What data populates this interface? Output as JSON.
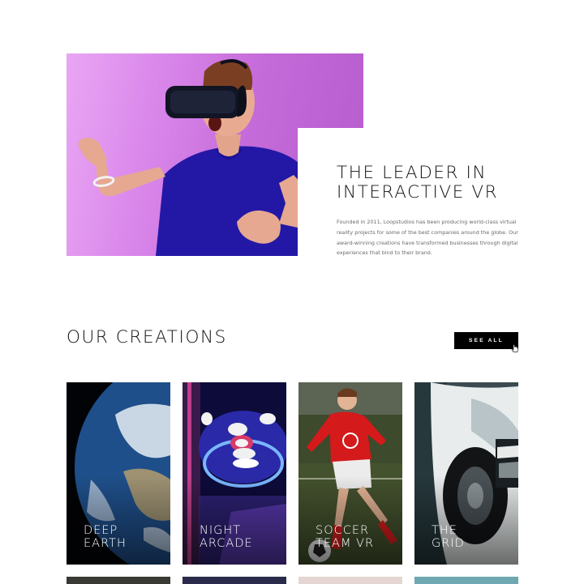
{
  "hero": {
    "title": "THE LEADER IN\nINTERACTIVE VR",
    "body": "Founded in 2011, Loopstudios has been producing world-class virtual reality projects for some of the best companies around the globe. Our award-winning creations have transformed businesses through digital experiences that bind to their brand.",
    "image_subject": "man-wearing-vr-headset"
  },
  "creations": {
    "title": "OUR CREATIONS",
    "see_all_label": "SEE ALL",
    "items": [
      {
        "label": "DEEP\nEARTH",
        "image": "earth-from-space"
      },
      {
        "label": "NIGHT\nARCADE",
        "image": "arcade-skeeball"
      },
      {
        "label": "SOCCER\nTEAM VR",
        "image": "soccer-player"
      },
      {
        "label": "THE\nGRID",
        "image": "race-car"
      }
    ]
  },
  "colors": {
    "accent": "#000000",
    "hero_gradient_start": "#e9a6f4",
    "hero_gradient_end": "#b65ccd",
    "body_text": "#6a6a6a"
  }
}
